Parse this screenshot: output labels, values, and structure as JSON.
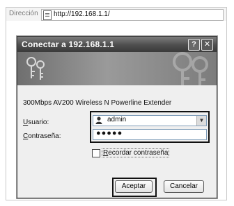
{
  "address_bar": {
    "label": "Dirección",
    "url": "http://192.168.1.1/"
  },
  "dialog": {
    "title": "Conectar a 192.168.1.1",
    "help_glyph": "?",
    "close_glyph": "✕",
    "product": "300Mbps AV200 Wireless N Powerline Extender",
    "username_label_first": "U",
    "username_label_rest": "suario:",
    "password_label_first": "C",
    "password_label_rest": "ontraseña:",
    "username_value": "admin",
    "password_mask": "●●●●●",
    "remember_first": "R",
    "remember_rest": "ecordar contraseña",
    "ok_label": "Aceptar",
    "cancel_label": "Cancelar",
    "icons": [
      "page-icon",
      "help-icon",
      "close-icon",
      "keys-icon",
      "user-icon",
      "chevron-down-icon"
    ]
  }
}
